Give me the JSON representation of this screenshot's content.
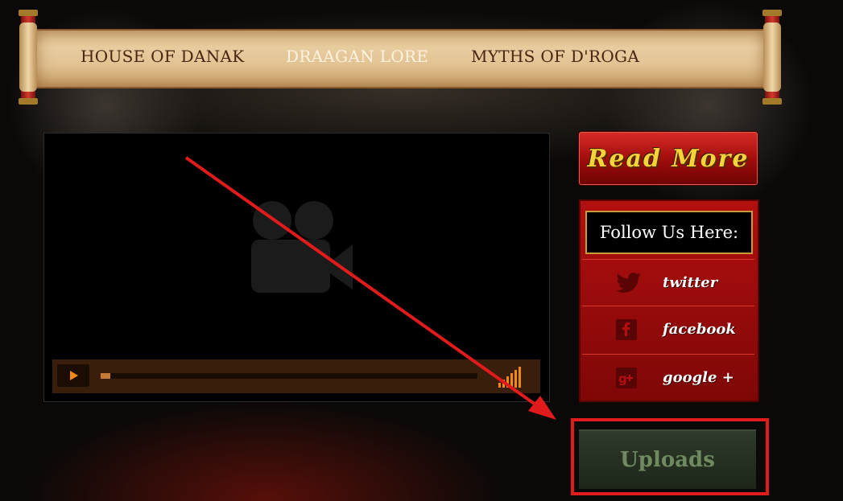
{
  "nav": {
    "items": [
      {
        "label": "HOUSE OF DANAK",
        "active": false
      },
      {
        "label": "DRAAGAN LORE",
        "active": true
      },
      {
        "label": "MYTHS OF D'ROGA",
        "active": false
      }
    ]
  },
  "video": {
    "placeholder_icon": "video-camera-icon",
    "play_icon": "play-icon",
    "volume_icon": "volume-bars-icon"
  },
  "sidebar": {
    "read_more_label": "Read More",
    "follow_title": "Follow Us Here:",
    "social": [
      {
        "label": "twitter",
        "icon": "twitter-icon"
      },
      {
        "label": "facebook",
        "icon": "facebook-icon"
      },
      {
        "label": "google +",
        "icon": "google-plus-icon"
      }
    ],
    "uploads_label": "Uploads"
  },
  "annotation": {
    "color": "#e11b1b"
  }
}
